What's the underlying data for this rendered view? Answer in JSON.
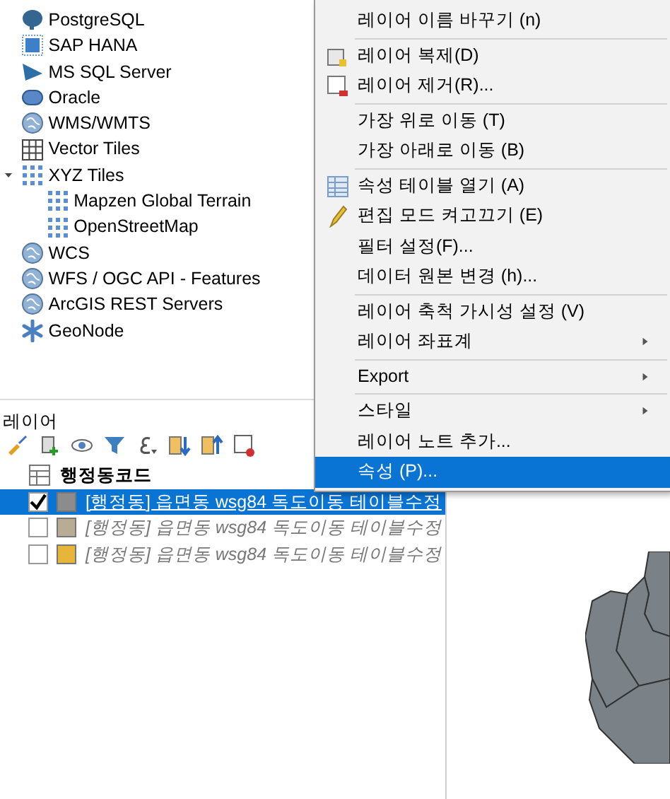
{
  "browser": {
    "items": [
      {
        "label": "PostgreSQL"
      },
      {
        "label": "SAP HANA"
      },
      {
        "label": "MS SQL Server"
      },
      {
        "label": "Oracle"
      },
      {
        "label": "WMS/WMTS"
      },
      {
        "label": "Vector Tiles"
      },
      {
        "label": "XYZ Tiles",
        "expanded": true,
        "children": [
          {
            "label": "Mapzen Global Terrain"
          },
          {
            "label": "OpenStreetMap"
          }
        ]
      },
      {
        "label": "WCS"
      },
      {
        "label": "WFS / OGC API - Features"
      },
      {
        "label": "ArcGIS REST Servers"
      },
      {
        "label": "GeoNode"
      }
    ]
  },
  "layers": {
    "title": "레이어",
    "group": {
      "label": "행정동코드",
      "children": [
        {
          "label": "[행정동] 읍면동 wsg84 독도이동 테이블수정",
          "checked": true,
          "selected": true,
          "color": "#8c8c8c"
        },
        {
          "label": "[행정동] 읍면동 wsg84 독도이동 테이블수정",
          "checked": false,
          "selected": false,
          "color": "#b8ac94"
        },
        {
          "label": "[행정동] 읍면동 wsg84 독도이동 테이블수정",
          "checked": false,
          "selected": false,
          "color": "#e6b53a"
        }
      ]
    }
  },
  "context_menu": {
    "items": [
      {
        "kind": "item",
        "label": "레이어 이름 바꾸기 (n)",
        "selected": false
      },
      {
        "kind": "separator"
      },
      {
        "kind": "item",
        "label": "레이어 복제(D)",
        "selected": false
      },
      {
        "kind": "item",
        "label": "레이어 제거(R)...",
        "selected": false
      },
      {
        "kind": "separator"
      },
      {
        "kind": "item",
        "label": "가장 위로 이동 (T)",
        "selected": false
      },
      {
        "kind": "item",
        "label": "가장 아래로 이동 (B)",
        "selected": false
      },
      {
        "kind": "separator"
      },
      {
        "kind": "item",
        "label": "속성 테이블 열기 (A)",
        "selected": false
      },
      {
        "kind": "item",
        "label": "편집 모드 켜고끄기 (E)",
        "selected": false
      },
      {
        "kind": "item",
        "label": "필터 설정(F)...",
        "selected": false
      },
      {
        "kind": "item",
        "label": "데이터 원본 변경 (h)...",
        "selected": false
      },
      {
        "kind": "separator"
      },
      {
        "kind": "item",
        "label": "레이어 축척 가시성 설정 (V)",
        "selected": false
      },
      {
        "kind": "item",
        "label": "레이어 좌표계",
        "submenu": true,
        "selected": false
      },
      {
        "kind": "separator"
      },
      {
        "kind": "item",
        "label": "Export",
        "submenu": true,
        "selected": false
      },
      {
        "kind": "separator"
      },
      {
        "kind": "item",
        "label": "스타일",
        "submenu": true,
        "selected": false
      },
      {
        "kind": "item",
        "label": "레이어 노트 추가...",
        "selected": false
      },
      {
        "kind": "item",
        "label": "속성 (P)...",
        "selected": true
      }
    ]
  }
}
